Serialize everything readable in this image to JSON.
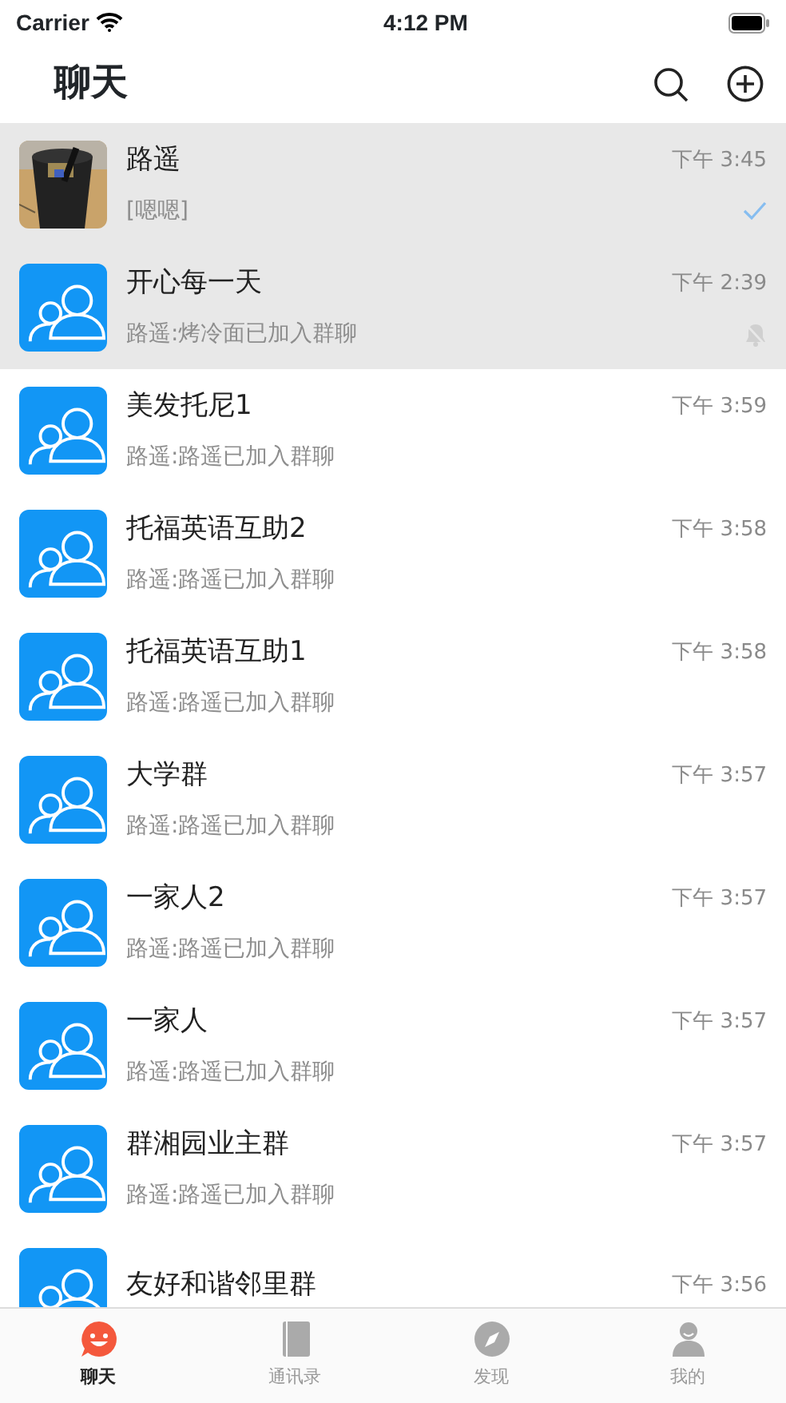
{
  "status_bar": {
    "carrier": "Carrier",
    "time": "4:12 PM"
  },
  "header": {
    "title": "聊天"
  },
  "chats": [
    {
      "name": "路遥",
      "preview": "[嗯嗯]",
      "time": "下午 3:45",
      "pinned": true,
      "read": true,
      "muted": false
    },
    {
      "name": "开心每一天",
      "preview": "路遥:烤冷面已加入群聊",
      "time": "下午 2:39",
      "pinned": true,
      "kind": "group",
      "read": false,
      "muted": true
    },
    {
      "name": "美发托尼1",
      "preview": "路遥:路遥已加入群聊",
      "time": "下午 3:59",
      "pinned": false,
      "kind": "group",
      "read": false,
      "muted": false
    },
    {
      "name": "托福英语互助2",
      "preview": "路遥:路遥已加入群聊",
      "time": "下午 3:58",
      "pinned": false,
      "kind": "group",
      "read": false,
      "muted": false
    },
    {
      "name": "托福英语互助1",
      "preview": "路遥:路遥已加入群聊",
      "time": "下午 3:58",
      "pinned": false,
      "kind": "group",
      "read": false,
      "muted": false
    },
    {
      "name": "大学群",
      "preview": "路遥:路遥已加入群聊",
      "time": "下午 3:57",
      "pinned": false,
      "kind": "group",
      "read": false,
      "muted": false
    },
    {
      "name": "一家人2",
      "preview": "路遥:路遥已加入群聊",
      "time": "下午 3:57",
      "pinned": false,
      "kind": "group",
      "read": false,
      "muted": false
    },
    {
      "name": "一家人",
      "preview": "路遥:路遥已加入群聊",
      "time": "下午 3:57",
      "pinned": false,
      "kind": "group",
      "read": false,
      "muted": false
    },
    {
      "name": "群湘园业主群",
      "preview": "路遥:路遥已加入群聊",
      "time": "下午 3:57",
      "pinned": false,
      "kind": "group",
      "read": false,
      "muted": false
    },
    {
      "name": "友好和谐邻里群",
      "time": "下午 3:56",
      "pinned": false,
      "kind": "group",
      "read": false,
      "muted": false
    }
  ],
  "tabs": [
    {
      "label": "聊天",
      "kind": "chat",
      "selected": true
    },
    {
      "label": "通讯录",
      "kind": "contacts",
      "selected": false
    },
    {
      "label": "发现",
      "kind": "discover",
      "selected": false
    },
    {
      "label": "我的",
      "kind": "me",
      "selected": false
    }
  ]
}
